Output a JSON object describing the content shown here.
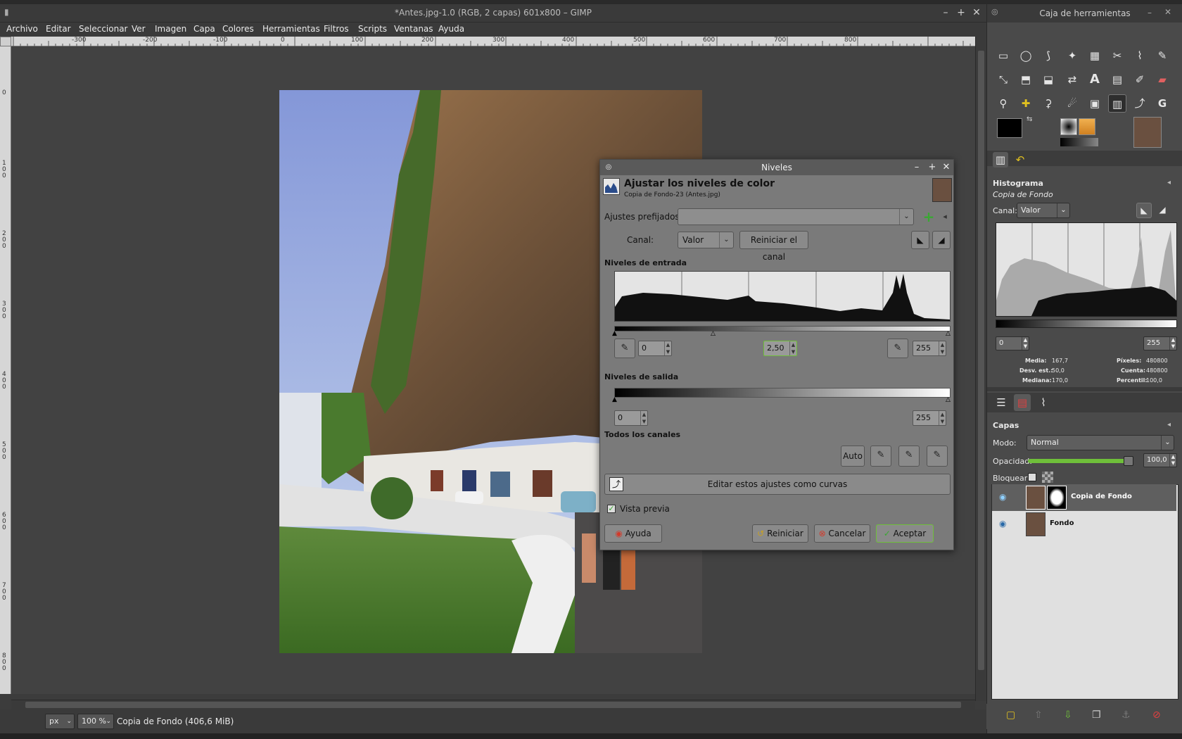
{
  "window": {
    "title": "*Antes.jpg-1.0 (RGB, 2 capas) 601x800 – GIMP",
    "controls": [
      "–",
      "+",
      "✕"
    ]
  },
  "menu": [
    "Archivo",
    "Editar",
    "Seleccionar",
    "Ver",
    "Imagen",
    "Capa",
    "Colores",
    "Herramientas",
    "Filtros",
    "Scripts",
    "Ventanas",
    "Ayuda"
  ],
  "ruler": {
    "top": [
      "-300",
      "-200",
      "-100",
      "0",
      "100",
      "200",
      "300",
      "400",
      "500",
      "600",
      "700",
      "800"
    ],
    "left": [
      "0",
      "1\n0\n0",
      "2\n0\n0",
      "3\n0\n0",
      "4\n0\n0",
      "5\n0\n0",
      "6\n0\n0",
      "7\n0\n0",
      "8\n0\n0"
    ]
  },
  "statusbar": {
    "unit": "px",
    "zoom": "100 %",
    "info": "Copia de Fondo (406,6 MiB)"
  },
  "levels_dialog": {
    "title": "Niveles",
    "heading": "Ajustar los niveles de color",
    "subheading": "Copia de Fondo-23 (Antes.jpg)",
    "presets_label": "Ajustes prefijados:",
    "presets_value": "",
    "channel_label": "Canal:",
    "channel_value": "Valor",
    "reset_channel": "Reiniciar el canal",
    "input_levels_label": "Niveles de entrada",
    "input_low": "0",
    "input_gamma": "2,50",
    "input_high": "255",
    "output_levels_label": "Niveles de salida",
    "output_low": "0",
    "output_high": "255",
    "all_channels_label": "Todos los canales",
    "auto_button": "Auto",
    "edit_curves_button": "Editar estos ajustes como curvas",
    "preview_label": "Vista previa",
    "preview_checked": true,
    "help_button": "Ayuda",
    "reset_button": "Reiniciar",
    "cancel_button": "Cancelar",
    "ok_button": "Aceptar"
  },
  "dock": {
    "title": "Caja de herramientas",
    "histogram": {
      "title": "Histograma",
      "layer": "Copia de Fondo",
      "channel_label": "Canal:",
      "channel_value": "Valor",
      "range_low": "0",
      "range_high": "255",
      "stats": [
        {
          "label": "Media:",
          "value": "167,7"
        },
        {
          "label": "Desv. est.:",
          "value": "50,0"
        },
        {
          "label": "Mediana:",
          "value": "170,0"
        },
        {
          "label": "Píxeles:",
          "value": "480800"
        },
        {
          "label": "Cuenta:",
          "value": "480800"
        },
        {
          "label": "Percentil:",
          "value": "100,0"
        }
      ]
    },
    "layers": {
      "title": "Capas",
      "mode_label": "Modo:",
      "mode_value": "Normal",
      "opacity_label": "Opacidad:",
      "opacity_value": "100,0",
      "opacity_fraction": 1.0,
      "lock_label": "Bloquear:",
      "items": [
        {
          "name": "Copia de Fondo",
          "selected": true,
          "has_mask": true
        },
        {
          "name": "Fondo",
          "selected": false,
          "has_mask": false
        }
      ]
    }
  },
  "colors": {
    "accent_green": "#6fbf3a",
    "cancel_red": "#d23a2a",
    "ok_green": "#3aa832"
  }
}
